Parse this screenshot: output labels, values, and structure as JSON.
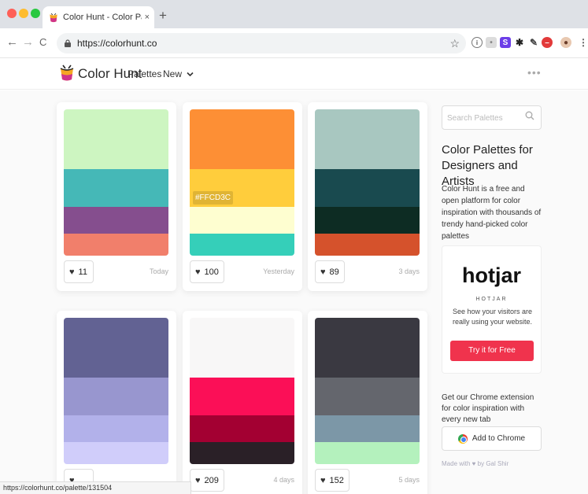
{
  "browser": {
    "tab_title": "Color Hunt - Color Palettes for",
    "tab_close": "×",
    "new_tab": "+",
    "url": "https://colorhunt.co",
    "back": "←",
    "forward": "→",
    "reload": "C"
  },
  "site": {
    "brand": "Color Hunt",
    "nav": {
      "palettes": "Palettes",
      "new": "New"
    },
    "more": "•••"
  },
  "palettes": [
    {
      "colors": [
        "#cdf5c1",
        "#45b8b7",
        "#854e8e",
        "#f17f6b"
      ],
      "likes": "11",
      "date": "Today"
    },
    {
      "colors": [
        "#fd8f35",
        "#ffcd3c",
        "#fefed0",
        "#35cfb9"
      ],
      "likes": "100",
      "date": "Yesterday",
      "hex_label": "#FFCD3C"
    },
    {
      "colors": [
        "#a8c7c0",
        "#194a4f",
        "#0d2c23",
        "#d5522c"
      ],
      "likes": "89",
      "date": "3 days"
    },
    {
      "colors": [
        "#626293",
        "#9896cf",
        "#b2b1ea",
        "#d0cdfa"
      ],
      "likes": "",
      "date": ""
    },
    {
      "colors": [
        "#f8f7f7",
        "#fb0f57",
        "#a30032",
        "#2a2027"
      ],
      "likes": "209",
      "date": "4 days"
    },
    {
      "colors": [
        "#3a3941",
        "#64666d",
        "#7c97a7",
        "#b4f1bd"
      ],
      "likes": "152",
      "date": "5 days"
    }
  ],
  "sidebar": {
    "search_placeholder": "Search Palettes",
    "title": "Color Palettes for Designers and Artists",
    "description": "Color Hunt is a free and open platform for color inspiration with thousands of trendy hand-picked color palettes",
    "ad": {
      "logo": "hotjar",
      "name": "HOTJAR",
      "text": "See how your visitors are really using your website.",
      "button": "Try it for Free"
    },
    "extension_text": "Get our Chrome extension for color inspiration with every new tab",
    "add_to_chrome": "Add to Chrome",
    "made_with": "Made with ♥ by Gal Shir"
  },
  "status_url": "https://colorhunt.co/palette/131504"
}
